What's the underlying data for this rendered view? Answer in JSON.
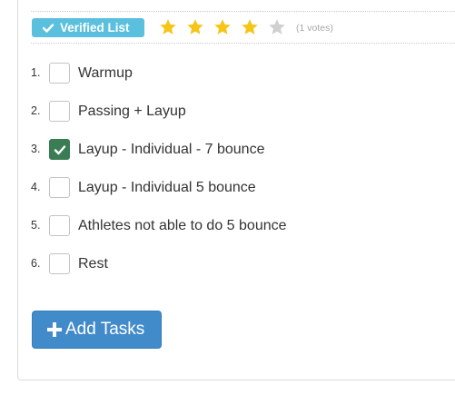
{
  "header": {
    "badge_label": "Verified List",
    "badge_icon": "check-icon",
    "rating": {
      "value": 4,
      "max": 5,
      "filled_color": "#f5c518",
      "empty_color": "#d0d0d0",
      "votes_text": "(1 votes)"
    }
  },
  "tasks": [
    {
      "number": "1.",
      "label": "Warmup",
      "checked": false
    },
    {
      "number": "2.",
      "label": "Passing + Layup",
      "checked": false
    },
    {
      "number": "3.",
      "label": "Layup - Individual - 7 bounce",
      "checked": true
    },
    {
      "number": "4.",
      "label": "Layup - Individual 5 bounce",
      "checked": false
    },
    {
      "number": "5.",
      "label": "Athletes not able to do 5 bounce",
      "checked": false
    },
    {
      "number": "6.",
      "label": "Rest",
      "checked": false
    }
  ],
  "actions": {
    "add_tasks_label": "Add Tasks",
    "add_tasks_icon": "plus-icon"
  },
  "colors": {
    "badge": "#5bc0de",
    "checked": "#3a7d54",
    "primary_button": "#428bca"
  }
}
